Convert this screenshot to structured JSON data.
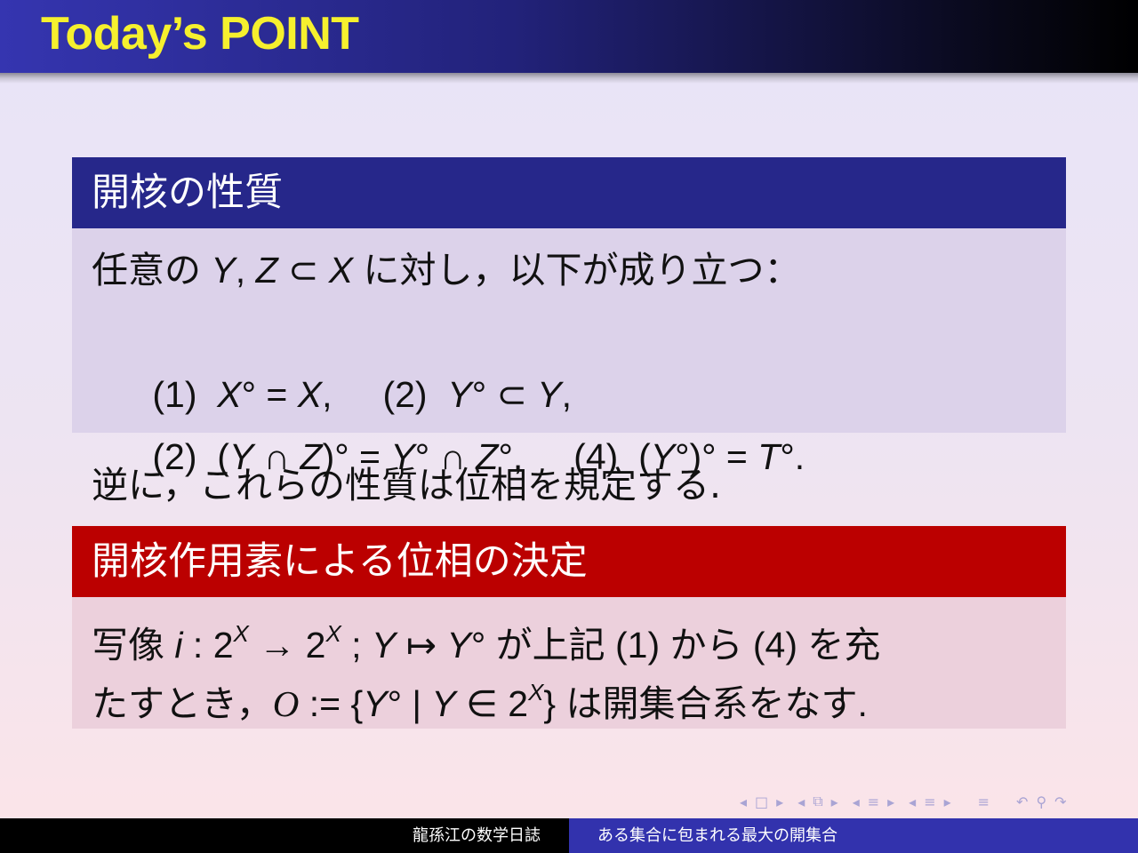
{
  "header": {
    "title": "Today’s POINT"
  },
  "theorem_block": {
    "title": "開核の性質",
    "lines": [
      {
        "parts": [
          "任意の ",
          "Y",
          ", ",
          "Z",
          " ⊂ ",
          "X",
          " に対し，以下が成り立つ："
        ]
      },
      {
        "parts": [
          "(1)  ",
          "X",
          "°",
          " = ",
          "X",
          ",     (2)  ",
          "Y",
          "°",
          " ⊂ ",
          "Y",
          ","
        ]
      },
      {
        "parts": [
          "(2)  (",
          "Y",
          " ∩ ",
          "Z",
          ")°",
          " = ",
          "Y",
          "° ∩ ",
          "Z",
          "°,     (4)  (",
          "Y",
          "°)° = ",
          "T",
          "°."
        ]
      }
    ]
  },
  "remark": "逆に，これらの性質は位相を規定する.",
  "definition_block": {
    "title": "開核作用素による位相の決定",
    "line1": {
      "prefix": "写像 ",
      "i": "i",
      "colon": " : 2",
      "sup1": "X",
      "arrow": " → 2",
      "sup2": "X",
      "semi": " ; ",
      "Y1": "Y",
      "mapsto": " ↦ ",
      "Y2": "Y",
      "circ": "°",
      "suffix": " が上記 (1) から (4) を充"
    },
    "line2": {
      "prefix": "たすとき，",
      "O": "O",
      "def": " := {",
      "Y1": "Y",
      "mid": "° | ",
      "Y2": "Y",
      "in": " ∈ 2",
      "sup": "X",
      "suffix": "} は開集合系をなす."
    }
  },
  "navigation": {
    "icons": [
      "◂",
      "□",
      "▸",
      "◂",
      "⧉",
      "▸",
      "◂",
      "≡",
      "▸",
      "◂",
      "≡",
      "▸",
      "≡",
      "↶",
      "⚲",
      "↷"
    ]
  },
  "footer": {
    "author": "龍孫江の数学日誌",
    "lecture_title": "ある集合に包まれる最大の開集合"
  }
}
